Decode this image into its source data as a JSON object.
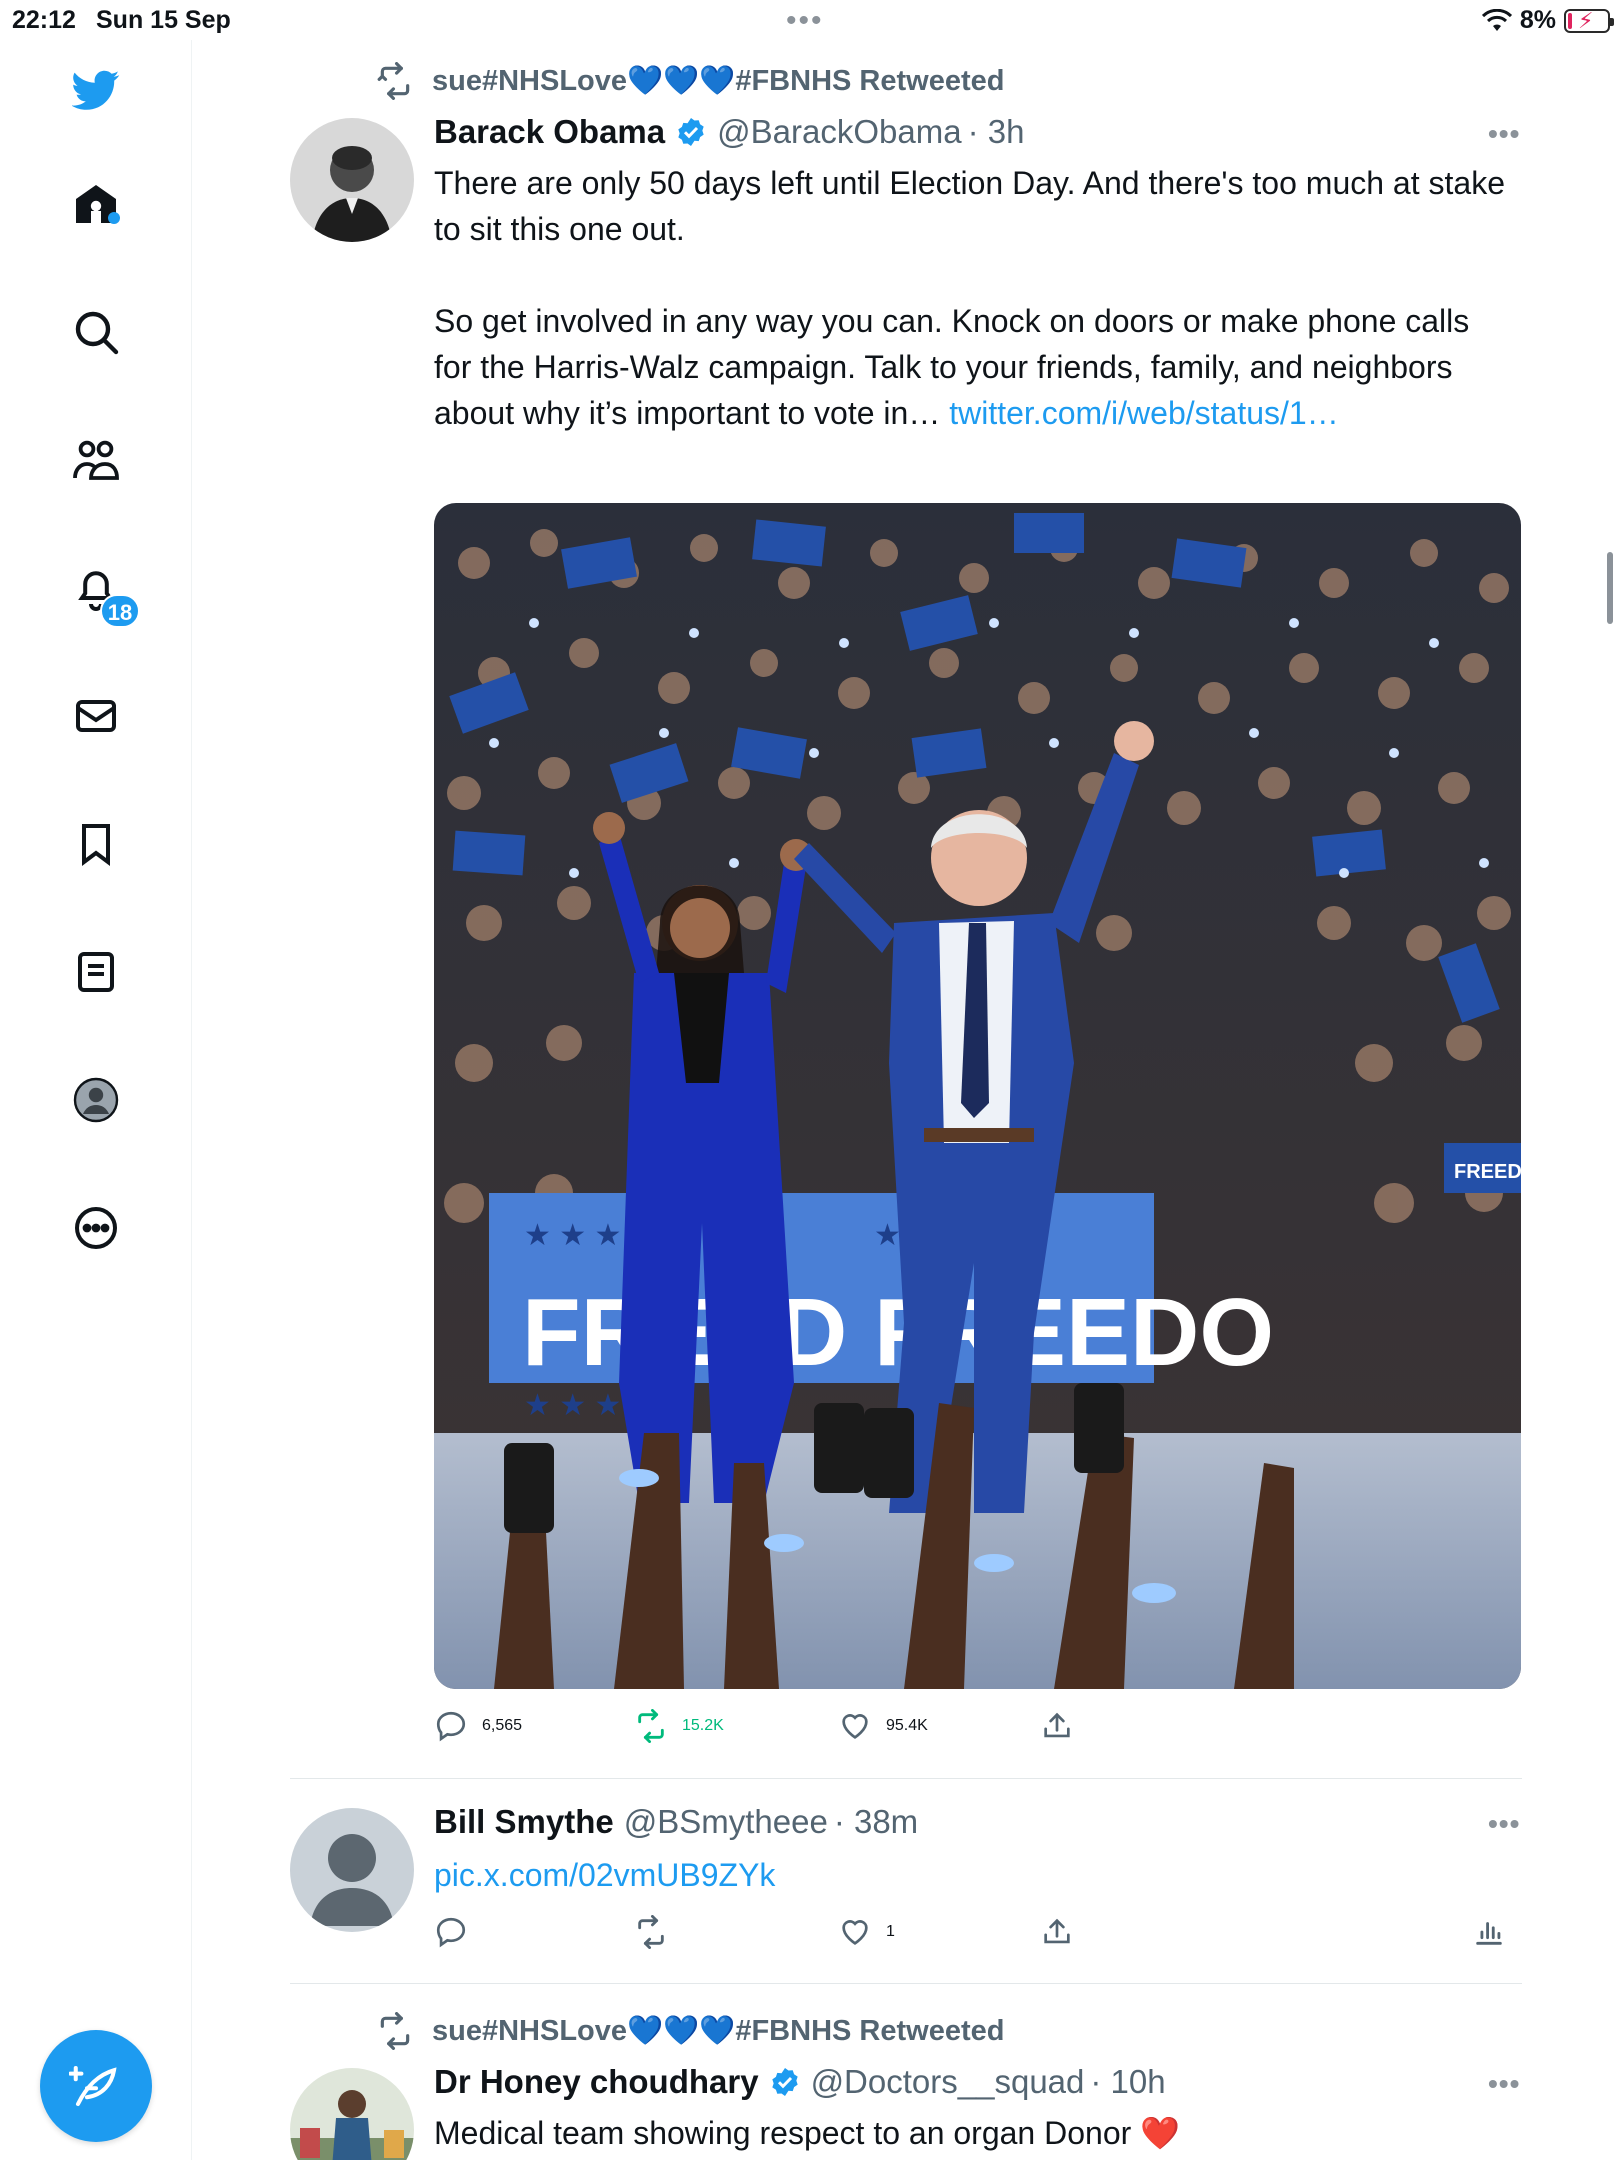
{
  "status_bar": {
    "time": "22:12",
    "date": "Sun 15 Sep",
    "battery": "8%"
  },
  "sidebar": {
    "items": [
      {
        "icon": "home-icon",
        "label": "Home"
      },
      {
        "icon": "search-icon",
        "label": "Explore"
      },
      {
        "icon": "communities-icon",
        "label": "Communities"
      },
      {
        "icon": "bell-icon",
        "label": "Notifications"
      },
      {
        "icon": "mail-icon",
        "label": "Messages"
      },
      {
        "icon": "bookmark-icon",
        "label": "Bookmarks"
      },
      {
        "icon": "lists-icon",
        "label": "Lists"
      },
      {
        "icon": "profile-icon",
        "label": "Profile"
      },
      {
        "icon": "more-circle-icon",
        "label": "More"
      }
    ],
    "notifications_badge": "18"
  },
  "tweets": [
    {
      "retweeted_by": "sue#NHSLove💙💙💙#FBNHS Retweeted",
      "name": "Barack Obama",
      "handle": "@BarackObama",
      "time": "· 3h",
      "text_p1": "There are only 50 days left until Election Day. And there's too much at stake to sit this one out.",
      "text_p2": "So get involved in any way you can. Knock on doors or make phone calls for the Harris-Walz campaign. Talk to your friends, family, and neighbors about why it’s important to vote in…",
      "link": "twitter.com/i/web/status/1…",
      "replies": "6,565",
      "retweets": "15.2K",
      "likes": "95.4K",
      "media_banner_left": "FREED",
      "media_banner_right": "FREEDO",
      "media_sign_right": "FREEDOM"
    },
    {
      "name": "Bill Smythe",
      "handle": "@BSmytheee",
      "time": "· 38m",
      "link": "pic.x.com/02vmUB9ZYk",
      "replies": "",
      "retweets": "",
      "likes": "1"
    },
    {
      "retweeted_by": "sue#NHSLove💙💙💙#FBNHS Retweeted",
      "name": "Dr Honey choudhary",
      "handle": "@Doctors__squad",
      "time": "· 10h",
      "text": "Medical team showing respect to an organ Donor ❤️"
    }
  ],
  "colors": {
    "accent": "#1d9bf0",
    "retweet_green": "#00ba7c",
    "muted": "#536471"
  }
}
